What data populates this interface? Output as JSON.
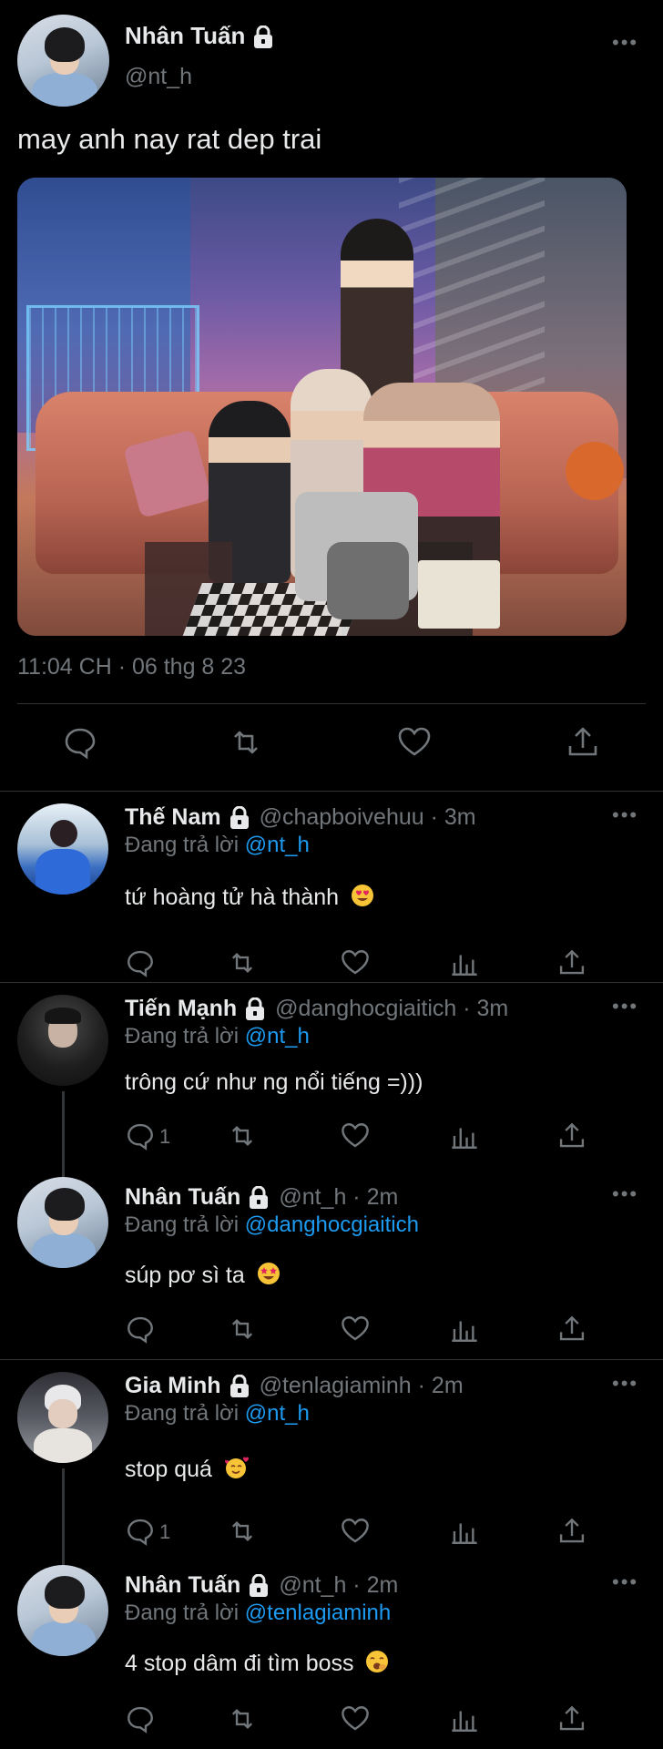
{
  "main_tweet": {
    "name": "Nhân Tuấn",
    "handle": "@nt_h",
    "text": "may anh nay rat dep trai",
    "timestamp": "11:04 CH · 06 thg 8 23",
    "actions": [
      "reply-icon",
      "retweet-icon",
      "like-icon",
      "share-icon"
    ]
  },
  "replies": [
    {
      "name": "Thế Nam",
      "handle": "@chapboivehuu · 3m",
      "replying_prefix": "Đang trả lời",
      "replying_to": "@nt_h",
      "text": "tứ hoàng tử hà thành",
      "emoji": "heart-eyes-emoji",
      "reply_count": ""
    },
    {
      "name": "Tiến Mạnh",
      "handle": "@danghocgiaitich · 3m",
      "replying_prefix": "Đang trả lời",
      "replying_to": "@nt_h",
      "text": "trông cứ như ng nổi tiếng =)))",
      "reply_count": "1"
    },
    {
      "name": "Nhân Tuấn",
      "handle": "@nt_h · 2m",
      "replying_prefix": "Đang trả lời",
      "replying_to": "@danghocgiaitich",
      "text": "súp pơ sì ta",
      "emoji": "star-struck-emoji",
      "reply_count": ""
    },
    {
      "name": "Gia Minh",
      "handle": "@tenlagiaminh · 2m",
      "replying_prefix": "Đang trả lời",
      "replying_to": "@nt_h",
      "text": "stop quá",
      "emoji": "smiling-hearts-emoji",
      "reply_count": "1"
    },
    {
      "name": "Nhân Tuấn",
      "handle": "@nt_h · 2m",
      "replying_prefix": "Đang trả lời",
      "replying_to": "@tenlagiaminh",
      "text": "4 stop dâm đi tìm boss",
      "emoji": "yawning-emoji",
      "reply_count": ""
    }
  ],
  "colors": {
    "background": "#000000",
    "text": "#e7e9ea",
    "muted": "#71767b",
    "accent": "#1d9bf0",
    "divider": "#2f3336"
  }
}
